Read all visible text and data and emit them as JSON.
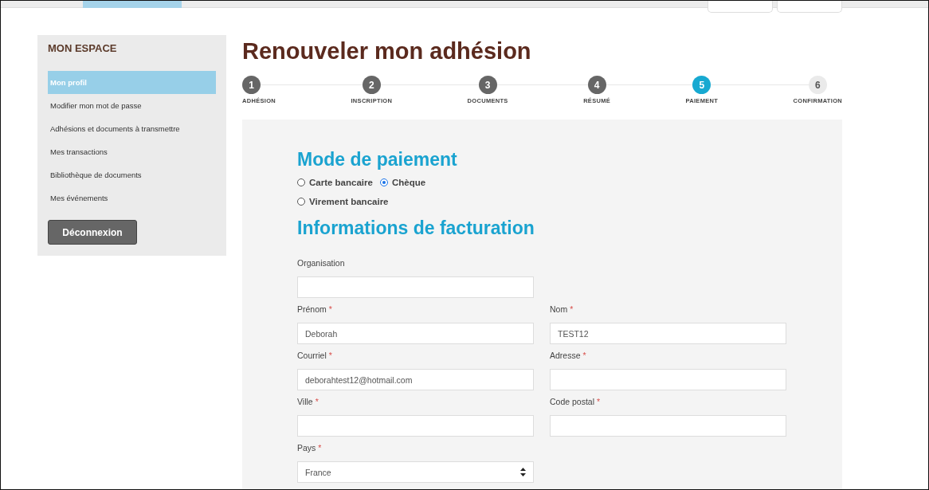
{
  "sidebar": {
    "title": "MON ESPACE",
    "items": [
      {
        "label": "Mon profil",
        "selected": true
      },
      {
        "label": "Modifier mon mot de passe",
        "selected": false
      },
      {
        "label": "Adhésions et documents à transmettre",
        "selected": false
      },
      {
        "label": "Mes transactions",
        "selected": false
      },
      {
        "label": "Bibliothèque de documents",
        "selected": false
      },
      {
        "label": "Mes événements",
        "selected": false
      }
    ],
    "logout": "Déconnexion"
  },
  "title": "Renouveler mon adhésion",
  "steps": [
    {
      "number": "1",
      "label": "ADHÉSION",
      "kind": "done"
    },
    {
      "number": "2",
      "label": "INSCRIPTION",
      "kind": "done"
    },
    {
      "number": "3",
      "label": "DOCUMENTS",
      "kind": "done"
    },
    {
      "number": "4",
      "label": "RÉSUMÉ",
      "kind": "done"
    },
    {
      "number": "5",
      "label": "PAIEMENT",
      "kind": "current"
    },
    {
      "number": "6",
      "label": "CONFIRMATION",
      "kind": "todo"
    }
  ],
  "payment": {
    "heading": "Mode de paiement",
    "options": [
      {
        "label": "Carte bancaire",
        "selected": false
      },
      {
        "label": "Chèque",
        "selected": true
      },
      {
        "label": "Virement bancaire",
        "selected": false
      }
    ]
  },
  "billing": {
    "heading": "Informations de facturation",
    "required_mark": "*",
    "rows": [
      [
        {
          "label": "Organisation",
          "required": false,
          "kind": "text"
        }
      ],
      [
        {
          "label": "Prénom",
          "required": true,
          "kind": "text",
          "value": "Deborah"
        },
        {
          "label": "Nom",
          "required": true,
          "kind": "text",
          "value": "TEST12"
        }
      ],
      [
        {
          "label": "Courriel",
          "required": true,
          "kind": "text",
          "value": "deborahtest12@hotmail.com"
        },
        {
          "label": "Adresse",
          "required": true,
          "kind": "text"
        }
      ],
      [
        {
          "label": "Ville",
          "required": true,
          "kind": "text"
        },
        {
          "label": "Code postal",
          "required": true,
          "kind": "text"
        }
      ],
      [
        {
          "label": "Pays",
          "required": true,
          "kind": "select",
          "value": "France"
        }
      ]
    ]
  }
}
